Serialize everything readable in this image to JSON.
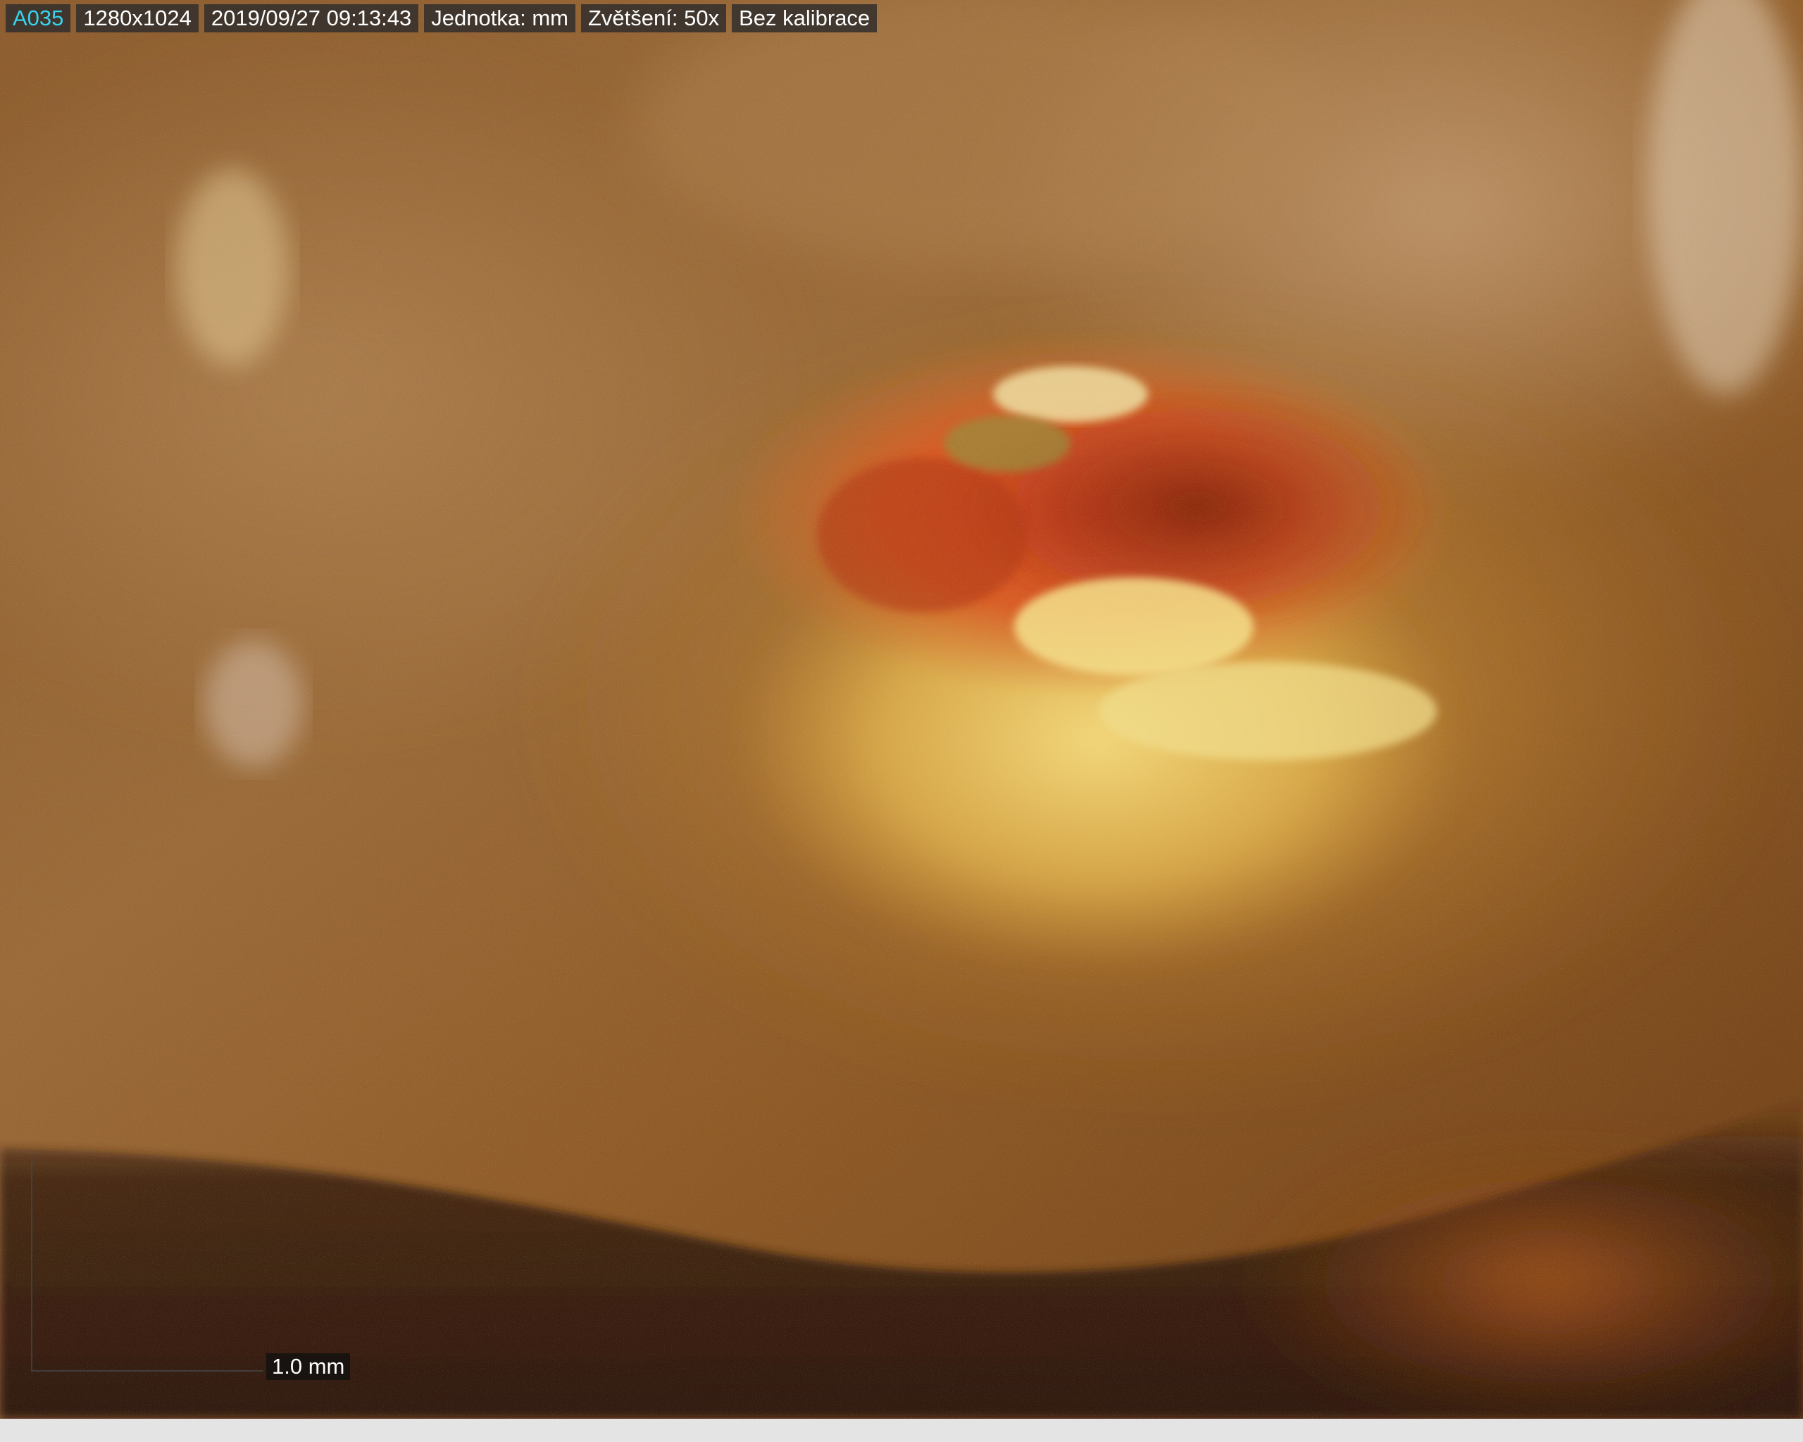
{
  "info_bar": {
    "image_id": "A035",
    "resolution": "1280x1024",
    "datetime": "2019/09/27 09:13:43",
    "unit": "Jednotka: mm",
    "magnification": "Zvětšení:  50x",
    "calibration": "Bez kalibrace"
  },
  "scale_bar": {
    "label": "1.0 mm"
  },
  "colors": {
    "id_text": "#36d4ee",
    "chip_background": "#34302c",
    "status_strip": "#e4e4e4"
  }
}
